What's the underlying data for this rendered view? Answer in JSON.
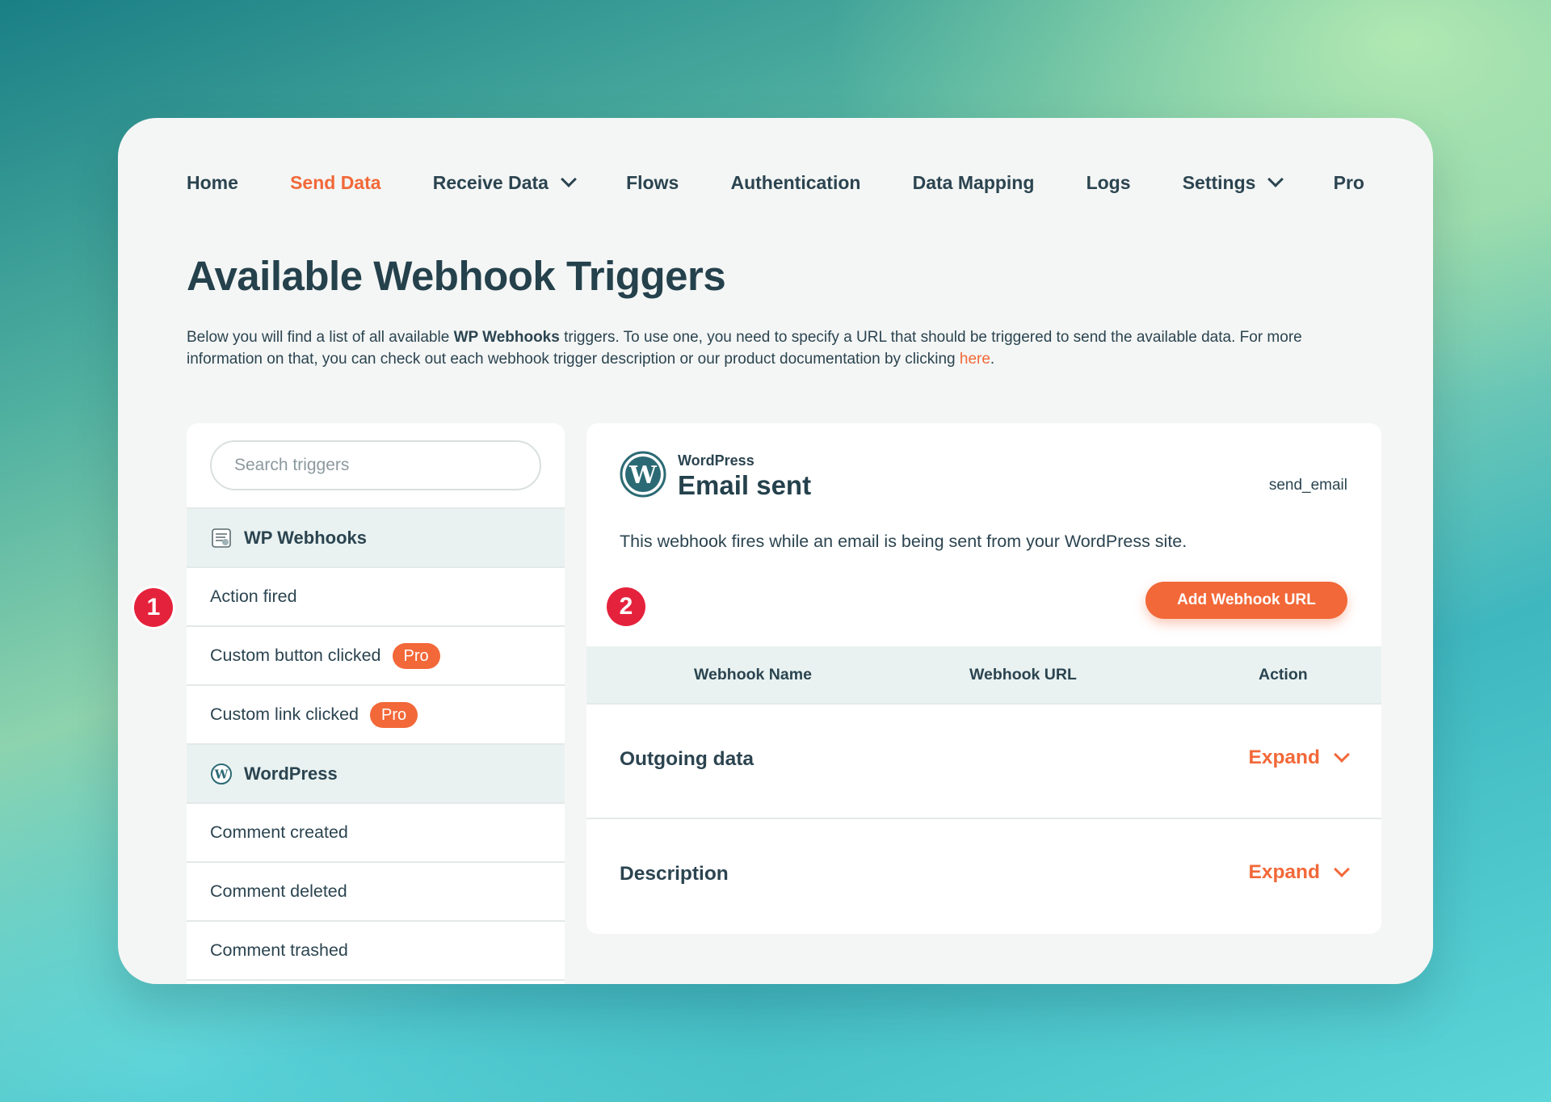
{
  "nav": {
    "items": [
      {
        "label": "Home",
        "active": false,
        "has_dropdown": false
      },
      {
        "label": "Send Data",
        "active": true,
        "has_dropdown": false
      },
      {
        "label": "Receive Data",
        "active": false,
        "has_dropdown": true
      },
      {
        "label": "Flows",
        "active": false,
        "has_dropdown": false
      },
      {
        "label": "Authentication",
        "active": false,
        "has_dropdown": false
      },
      {
        "label": "Data Mapping",
        "active": false,
        "has_dropdown": false
      },
      {
        "label": "Logs",
        "active": false,
        "has_dropdown": false
      },
      {
        "label": "Settings",
        "active": false,
        "has_dropdown": true
      },
      {
        "label": "Pro",
        "active": false,
        "has_dropdown": false
      }
    ]
  },
  "page": {
    "title": "Available Webhook Triggers",
    "desc_part1": "Below you will find a list of all available ",
    "desc_bold": "WP Webhooks",
    "desc_part2": " triggers. To use one, you need to specify a URL that should be triggered to send the available data. For more information on that, you can check out each webhook trigger description or our product documentation by clicking ",
    "desc_link": "here",
    "desc_end": "."
  },
  "sidebar": {
    "search_placeholder": "Search triggers",
    "groups": [
      {
        "label": "WP Webhooks",
        "icon": "wp-webhooks-logo-icon",
        "items": [
          {
            "label": "Action fired",
            "pro": ""
          },
          {
            "label": "Custom button clicked",
            "pro": "Pro"
          },
          {
            "label": "Custom link clicked",
            "pro": "Pro"
          }
        ]
      },
      {
        "label": "WordPress",
        "icon": "wordpress-logo-icon",
        "items": [
          {
            "label": "Comment created",
            "pro": ""
          },
          {
            "label": "Comment deleted",
            "pro": ""
          },
          {
            "label": "Comment trashed",
            "pro": ""
          }
        ]
      }
    ]
  },
  "trigger": {
    "vendor": "WordPress",
    "name": "Email sent",
    "slug": "send_email",
    "description": "This webhook fires while an email is being sent from your WordPress site.",
    "add_button": "Add Webhook URL",
    "table_headers": [
      "Webhook Name",
      "Webhook URL",
      "Action"
    ],
    "sections": [
      {
        "label": "Outgoing data",
        "action": "Expand"
      },
      {
        "label": "Description",
        "action": "Expand"
      }
    ]
  },
  "markers": [
    "1",
    "2"
  ],
  "colors": {
    "accent": "#f26838",
    "text": "#2b4450",
    "marker": "#e5223c",
    "group_bg": "#e9f2f1"
  }
}
